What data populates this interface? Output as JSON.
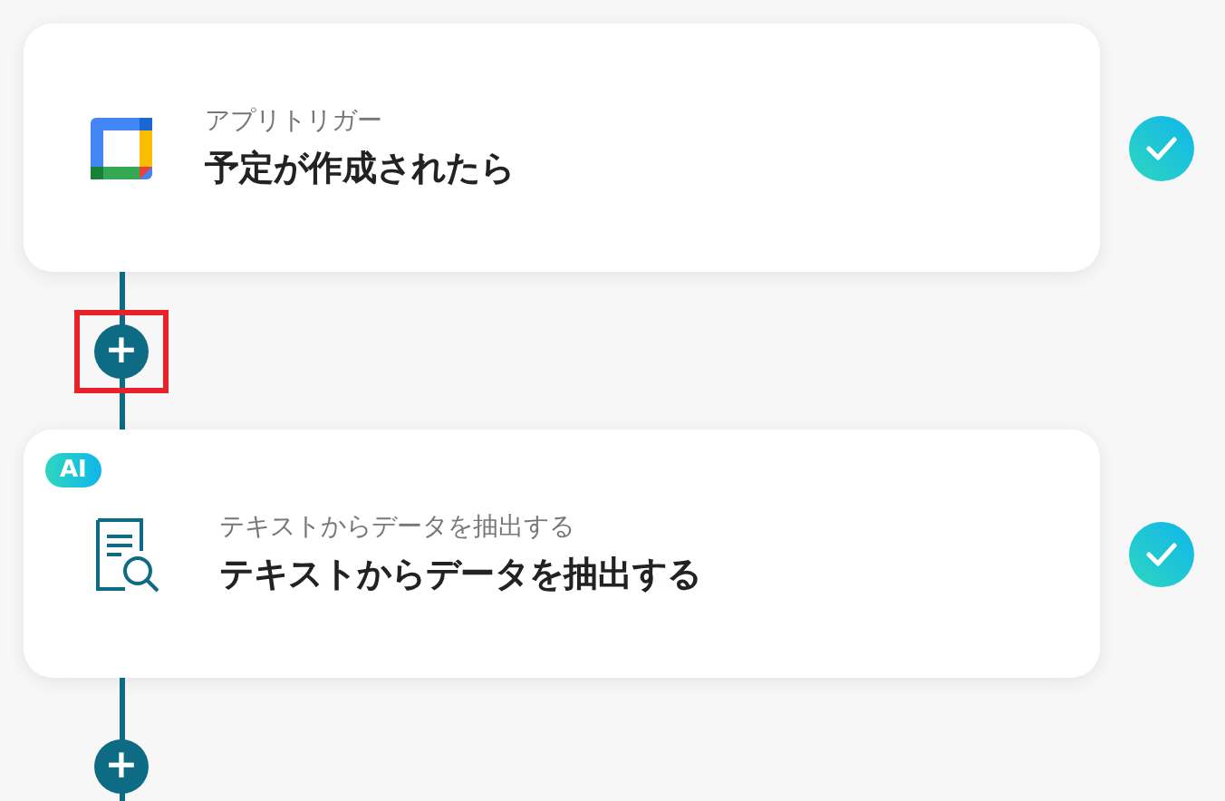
{
  "steps": [
    {
      "kind": "trigger",
      "caption": "アプリトリガー",
      "title": "予定が作成されたら",
      "completed": true,
      "add_after": {
        "label": "+",
        "highlighted": true
      }
    },
    {
      "kind": "ai",
      "badge": "AI",
      "caption": "テキストからデータを抽出する",
      "title": "テキストからデータを抽出する",
      "completed": true,
      "add_after": {
        "label": "+",
        "highlighted": false
      }
    }
  ]
}
